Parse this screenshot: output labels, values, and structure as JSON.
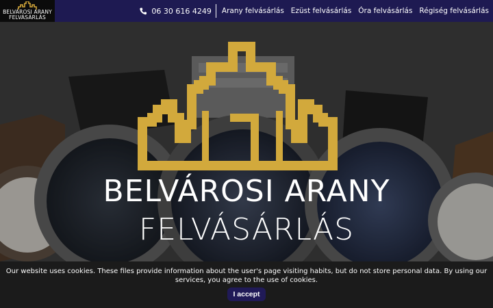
{
  "header": {
    "logo_line1": "BELVÁROSI ARANY",
    "logo_line2": "FELVÁSÁRLÁS",
    "phone": "06 30 616 4249",
    "nav": [
      "Arany felvásárlás",
      "Ezüst felvásárlás",
      "Óra felvásárlás",
      "Régiség felvásárlás"
    ]
  },
  "hero": {
    "title_line1": "BELVÁROSI ARANY",
    "title_line2": "FELVÁSÁRLÁS"
  },
  "cookie": {
    "text": "Our website uses cookies. These files provide information about the user's page visiting habits, but do not store personal data. By using our services, you agree to the use of cookies.",
    "button": "I accept"
  },
  "colors": {
    "nav_bg": "#1e1a52",
    "gold": "#d4a83a",
    "cookie_bg": "#1b1b1b",
    "button_bg": "#201a57"
  },
  "icons": [
    "phone-icon",
    "skyline-logo-icon"
  ]
}
